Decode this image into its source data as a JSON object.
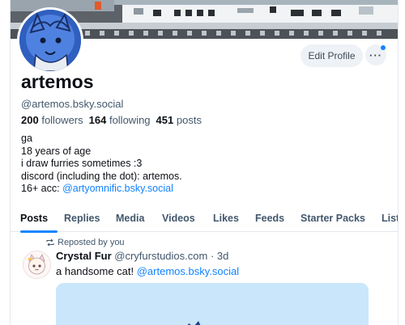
{
  "profile": {
    "display_name": "artemos",
    "handle": "@artemos.bsky.social",
    "followers_count": "200",
    "followers_label": "followers",
    "following_count": "164",
    "following_label": "following",
    "posts_count": "451",
    "posts_label": "posts",
    "bio": {
      "line1": "ga",
      "line2": "18 years of age",
      "line3": "i draw furries sometimes :3",
      "line4": "discord (including the dot): artemos.",
      "line5_prefix": "16+ acc: ",
      "line5_link": "@artyomnific.bsky.social"
    }
  },
  "actions": {
    "edit_profile_label": "Edit Profile",
    "more_label": "···"
  },
  "tabs": [
    "Posts",
    "Replies",
    "Media",
    "Videos",
    "Likes",
    "Feeds",
    "Starter Packs",
    "Lists"
  ],
  "active_tab": "Posts",
  "feed": {
    "repost_label": "Reposted by you",
    "post": {
      "author": "Crystal Fur",
      "handle": "@cryfurstudios.com",
      "separator": "·",
      "time": "3d",
      "text_prefix": "a handsome cat! ",
      "mention": "@artemos.bsky.social"
    }
  },
  "colors": {
    "accent": "#1185fe",
    "link": "#1083fe",
    "muted": "#42576c",
    "text": "#0b0f14",
    "button_bg": "#eef1f5",
    "media_bg": "#c9e6fb"
  },
  "icons": [
    "repost-icon",
    "more-dots-icon"
  ]
}
